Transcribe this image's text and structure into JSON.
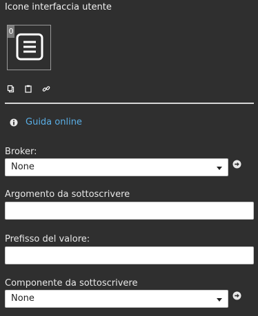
{
  "section": {
    "title": "Icone interfaccia utente"
  },
  "icon_tile": {
    "badge": "0",
    "icon": "list-icon"
  },
  "tools": [
    {
      "name": "copy-icon"
    },
    {
      "name": "paste-icon"
    },
    {
      "name": "link-icon"
    }
  ],
  "help": {
    "icon": "info-icon",
    "label": "Guida online",
    "link_color": "#5aafe6"
  },
  "fields": {
    "broker": {
      "label": "Broker:",
      "value": "None"
    },
    "argomento": {
      "label": "Argomento da sottoscrivere",
      "value": ""
    },
    "prefisso": {
      "label": "Prefisso del valore:",
      "value": ""
    },
    "componente": {
      "label": "Componente da sottoscrivere",
      "value": "None"
    }
  },
  "colors": {
    "background": "#2f2f2f",
    "accent": "#5aafe6"
  }
}
